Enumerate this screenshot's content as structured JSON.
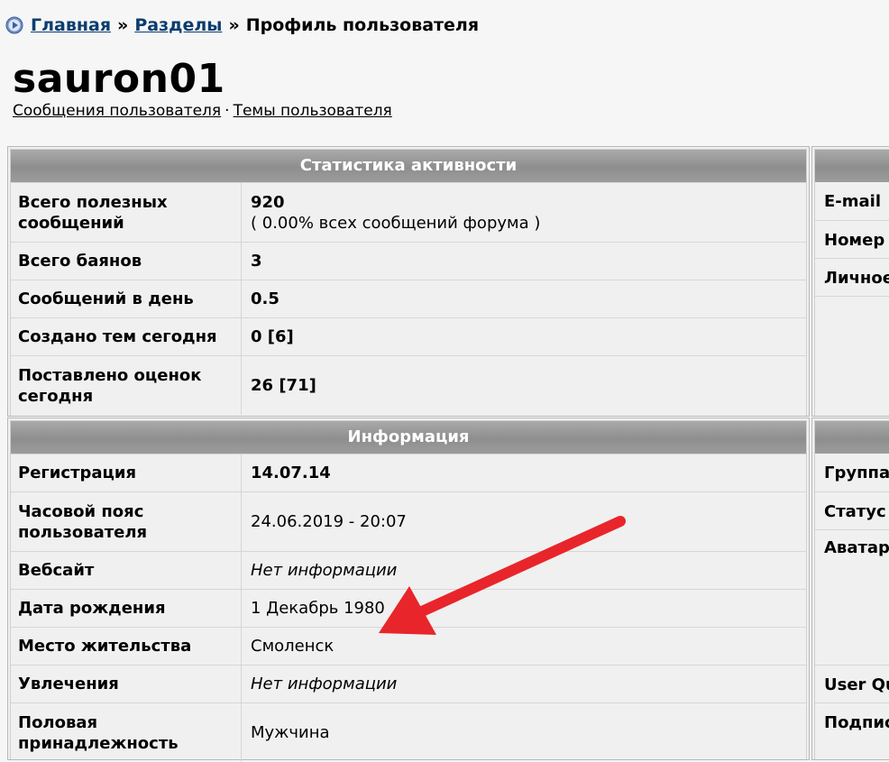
{
  "breadcrumb": {
    "home": "Главная",
    "sep1": "»",
    "sections": "Разделы",
    "sep2": "»",
    "current": "Профиль пользователя"
  },
  "user": {
    "name": "sauron01"
  },
  "sublinks": {
    "messages": "Сообщения пользователя",
    "dot": "·",
    "topics": "Темы пользователя"
  },
  "stats": {
    "title": "Статистика активности",
    "rows": [
      {
        "label": "Всего полезных сообщений",
        "value": "920",
        "sub": "( 0.00% всех сообщений форума )"
      },
      {
        "label": "Всего баянов",
        "value": "3"
      },
      {
        "label": "Сообщений в день",
        "value": "0.5"
      },
      {
        "label": "Создано тем сегодня",
        "value": "0 [6]"
      },
      {
        "label": "Поставлено оценок сегодня",
        "value": "26 [71]"
      }
    ]
  },
  "info": {
    "title": "Информация",
    "rows": [
      {
        "label": "Регистрация",
        "value": "14.07.14"
      },
      {
        "label": "Часовой пояс пользователя",
        "value": "24.06.2019 - 20:07"
      },
      {
        "label": "Вебсайт",
        "value": "Нет информации"
      },
      {
        "label": "Дата рождения",
        "value": "1 Декабрь 1980"
      },
      {
        "label": "Место жительства",
        "value": "Смоленск"
      },
      {
        "label": "Увлечения",
        "value": "Нет информации"
      },
      {
        "label": "Половая принадлежность",
        "value": "Мужчина"
      }
    ]
  },
  "right_top": {
    "rows": [
      "E-mail",
      "Номер",
      "Личное"
    ]
  },
  "right_bottom": {
    "rows": [
      "Группа",
      "Статус",
      "Аватар",
      "User Qu",
      "Подпис"
    ]
  },
  "colors": {
    "header_bg": "#999999",
    "link": "#0a3d6e",
    "arrow": "#e8252b",
    "page_bg": "#f6f6f6"
  }
}
